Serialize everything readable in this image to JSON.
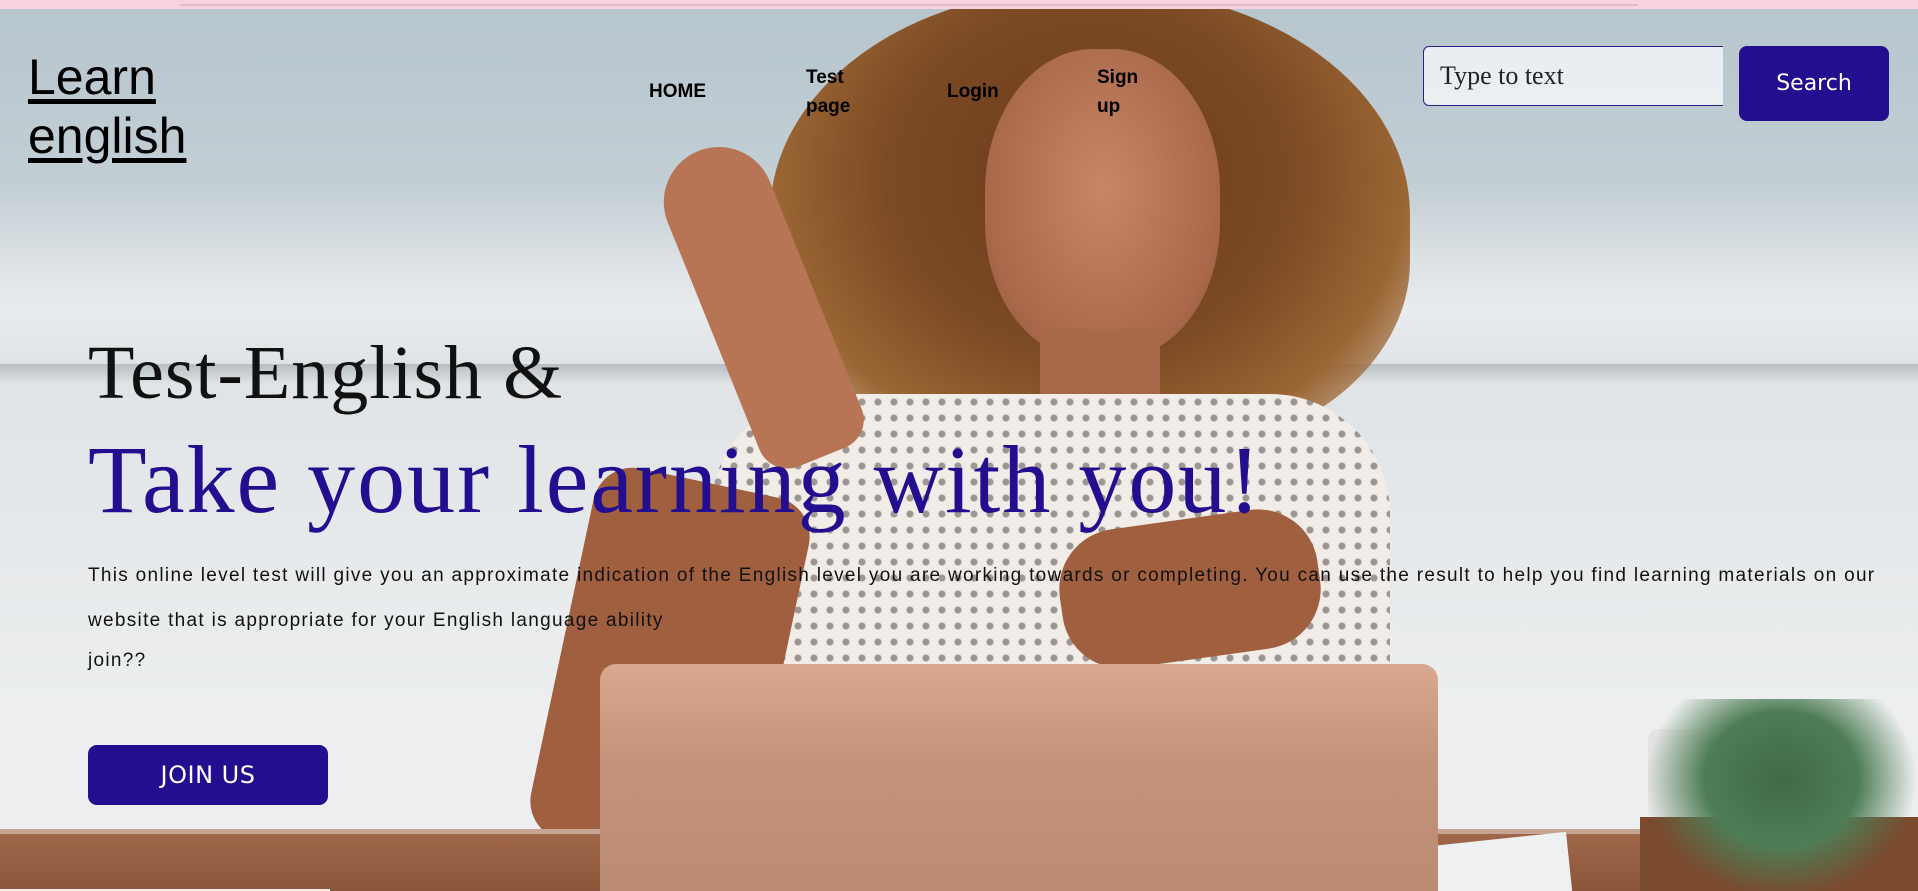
{
  "brand": {
    "logo_line1": "Learn",
    "logo_line2": "english"
  },
  "nav": {
    "items": [
      {
        "label": "HOME"
      },
      {
        "label": "Test page"
      },
      {
        "label": "Login"
      },
      {
        "label": "Sign up"
      }
    ]
  },
  "search": {
    "placeholder": "Type to text",
    "button_label": "Search"
  },
  "hero": {
    "line1": "Test-English &",
    "line2": "Take your learning with you!",
    "description": "This online level test will give you an approximate indication of the English level you are working towards or completing. You can use the result to help you find learning materials on our website that is appropriate for your English language ability",
    "join_question": "join??",
    "join_button_label": "JOIN US"
  },
  "colors": {
    "accent": "#230e8f",
    "topbar": "#f7d3e0"
  }
}
